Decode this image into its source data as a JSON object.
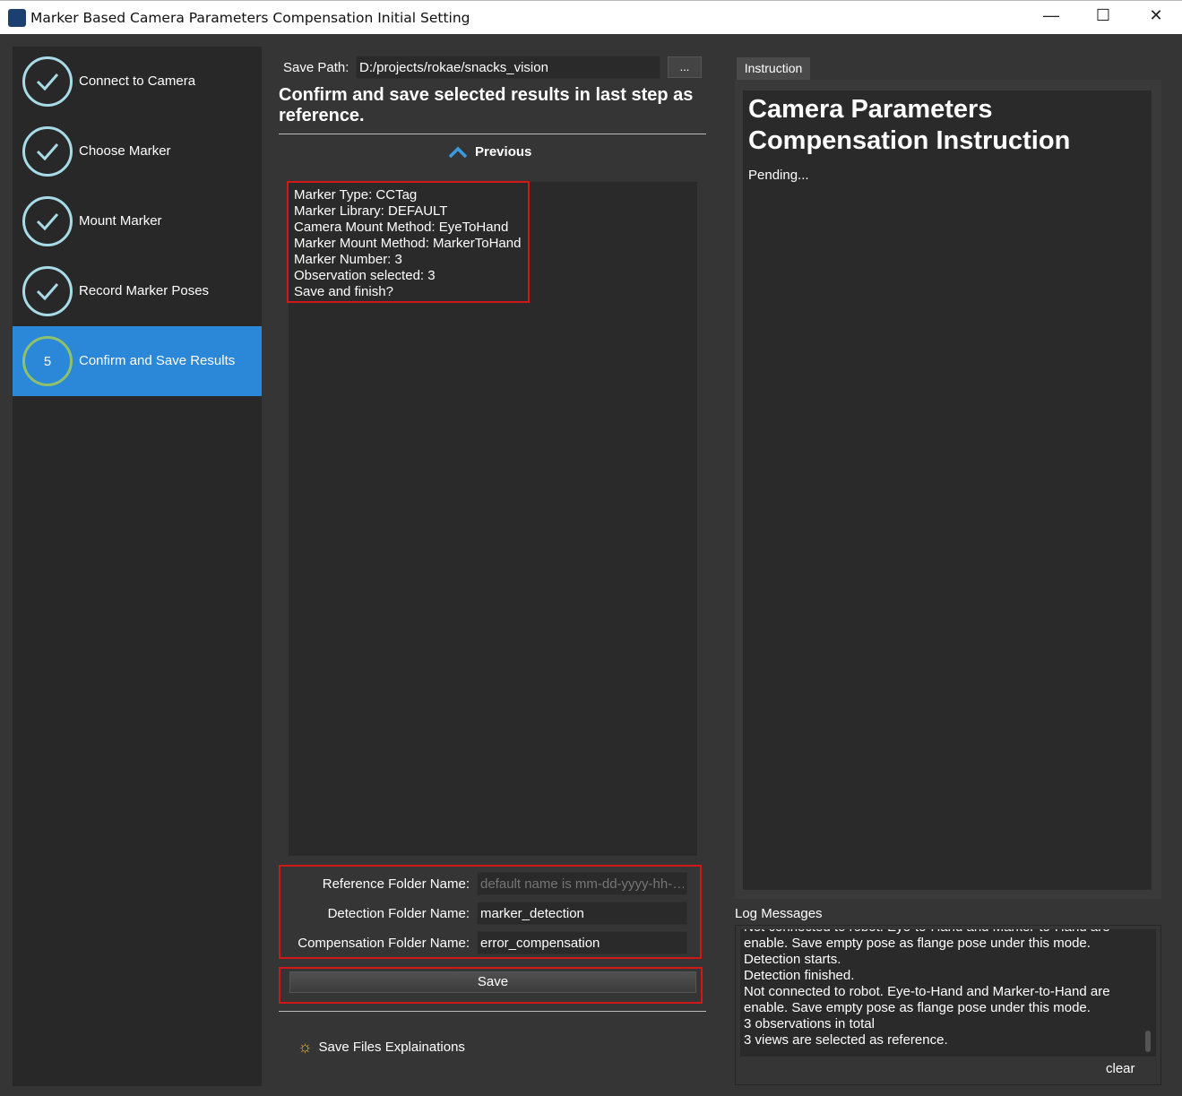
{
  "window": {
    "title": "Marker Based Camera Parameters Compensation Initial Setting",
    "minimize": "—",
    "maximize": "☐",
    "close": "✕"
  },
  "sidebar": {
    "steps": [
      {
        "label": "Connect to Camera",
        "state": "done"
      },
      {
        "label": "Choose Marker",
        "state": "done"
      },
      {
        "label": "Mount Marker",
        "state": "done"
      },
      {
        "label": "Record Marker Poses",
        "state": "done"
      },
      {
        "label": "Confirm and Save Results",
        "number": "5",
        "state": "active"
      }
    ]
  },
  "main": {
    "save_path_label": "Save Path:",
    "save_path_value": "D:/projects/rokae/snacks_vision",
    "browse_label": "...",
    "heading": "Confirm and save selected results in last step as reference.",
    "previous_label": "Previous",
    "summary": [
      "Marker Type: CCTag",
      "Marker Library: DEFAULT",
      "Camera Mount Method: EyeToHand",
      "Marker Mount Method: MarkerToHand",
      "Marker Number: 3",
      "Observation selected: 3",
      "Save and finish?"
    ],
    "reference_label": "Reference Folder Name:",
    "reference_placeholder": "default name is mm-dd-yyyy-hh-…",
    "detection_label": "Detection Folder Name:",
    "detection_value": "marker_detection",
    "compensation_label": "Compensation Folder Name:",
    "compensation_value": "error_compensation",
    "save_label": "Save",
    "explain_label": "Save Files Explainations"
  },
  "instruction": {
    "tab": "Instruction",
    "title": "Camera Parameters Compensation Instruction",
    "status": "Pending..."
  },
  "log": {
    "label": "Log Messages",
    "lines": [
      "Not connected to robot. Eye-to-Hand and Marker-to-Hand are",
      "enable. Save empty pose as flange pose under this mode.",
      "Detection starts.",
      "Detection finished.",
      "Not connected to robot. Eye-to-Hand and Marker-to-Hand are",
      "enable. Save empty pose as flange pose under this mode.",
      "3 observations in total",
      "3 views are selected as reference."
    ],
    "clear_label": "clear"
  },
  "colors": {
    "active_step": "#2b87d8",
    "done_ring": "#a8dbe8",
    "active_ring": "#8fc16a",
    "highlight": "#d01818"
  }
}
